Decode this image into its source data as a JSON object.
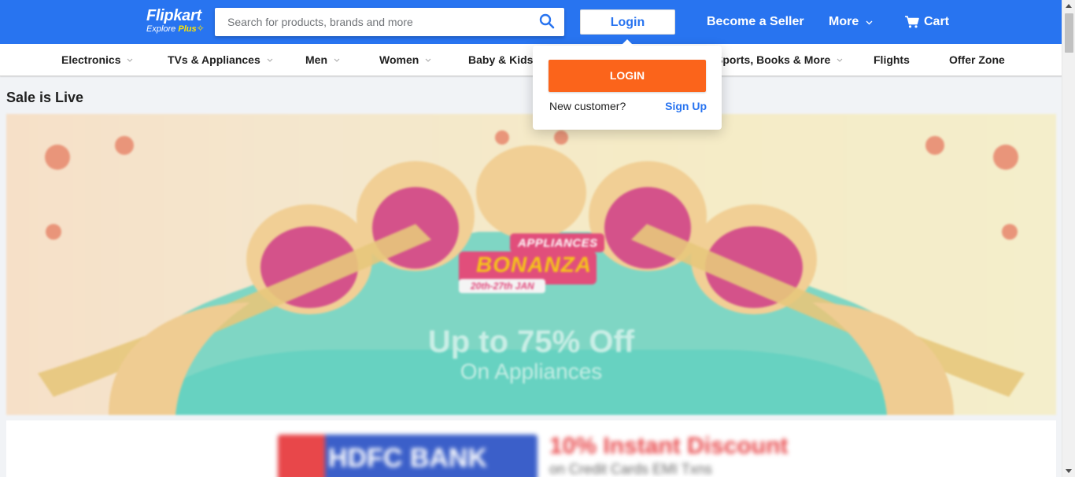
{
  "header": {
    "logo": "Flipkart",
    "logo_sub": "Explore",
    "logo_plus": "Plus",
    "search_placeholder": "Search for products, brands and more",
    "login_label": "Login",
    "become_seller": "Become a Seller",
    "more": "More",
    "cart": "Cart",
    "color": "#2874f0"
  },
  "nav": {
    "items": [
      {
        "label": "Electronics",
        "has_chevron": true
      },
      {
        "label": "TVs & Appliances",
        "has_chevron": true
      },
      {
        "label": "Men",
        "has_chevron": true
      },
      {
        "label": "Women",
        "has_chevron": true
      },
      {
        "label": "Baby & Kids",
        "has_chevron": true
      },
      {
        "label": "Sports, Books & More",
        "has_chevron": true
      },
      {
        "label": "Flights",
        "has_chevron": false
      },
      {
        "label": "Offer Zone",
        "has_chevron": false
      }
    ]
  },
  "sale": {
    "title": "Sale is Live",
    "banner": {
      "tag_small": "APPLIANCES",
      "tag_big": "BONANZA",
      "dates": "20th-27th JAN",
      "offer": "Up to 75% Off",
      "sub": "On Appliances"
    },
    "bank": {
      "name": "HDFC BANK",
      "offer": "10% Instant Discount",
      "sub": "on Credit Cards EMI Txns"
    }
  },
  "login_dropdown": {
    "button": "LOGIN",
    "new_customer": "New customer?",
    "signup": "Sign Up",
    "button_color": "#fb641b"
  }
}
